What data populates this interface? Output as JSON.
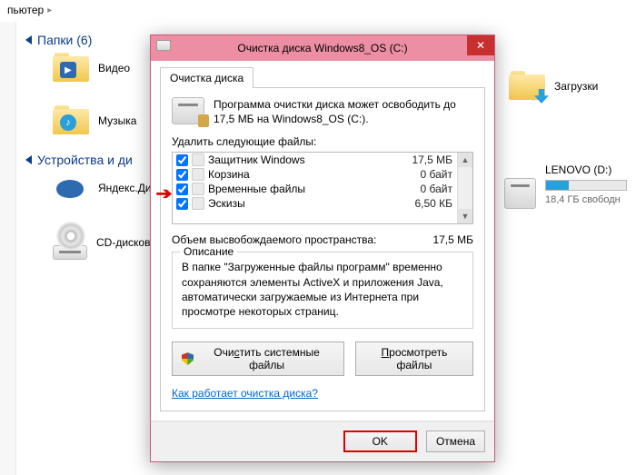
{
  "breadcrumb": {
    "text": "пьютер",
    "chevron": "▸"
  },
  "sections": {
    "folders_head": "Папки (6)",
    "devices_head": "Устройства и ди"
  },
  "folders": {
    "video": "Видео",
    "music": "Музыка",
    "downloads": "Загрузки",
    "yandex": "Яндекс.Ди",
    "cddrive": "CD-дисков"
  },
  "drive": {
    "name": "LENOVO (D:)",
    "fill_pct": 28,
    "free_text": "18,4 ГБ свободн"
  },
  "dialog": {
    "title": "Очистка диска Windows8_OS (C:)",
    "tab": "Очистка диска",
    "info": "Программа очистки диска может освободить до 17,5 МБ на Windows8_OS (C:).",
    "delete_label": "Удалить следующие файлы:",
    "items": [
      {
        "name": "Защитник Windows",
        "size": "17,5 МБ",
        "checked": true
      },
      {
        "name": "Корзина",
        "size": "0 байт",
        "checked": true
      },
      {
        "name": "Временные файлы",
        "size": "0 байт",
        "checked": true
      },
      {
        "name": "Эскизы",
        "size": "6,50 КБ",
        "checked": true
      }
    ],
    "total_label": "Объем высвобождаемого пространства:",
    "total_value": "17,5 МБ",
    "desc_legend": "Описание",
    "desc_text": "В папке \"Загруженные файлы программ\" временно сохраняются элементы ActiveX и приложения Java, автоматически загружаемые из Интернета при просмотре некоторых страниц.",
    "clean_sys": "Очистить системные файлы",
    "clean_sys_u": "с",
    "view_files": "Просмотреть файлы",
    "view_files_u": "П",
    "help_link": "Как работает очистка диска?",
    "ok": "OK",
    "cancel": "Отмена"
  }
}
